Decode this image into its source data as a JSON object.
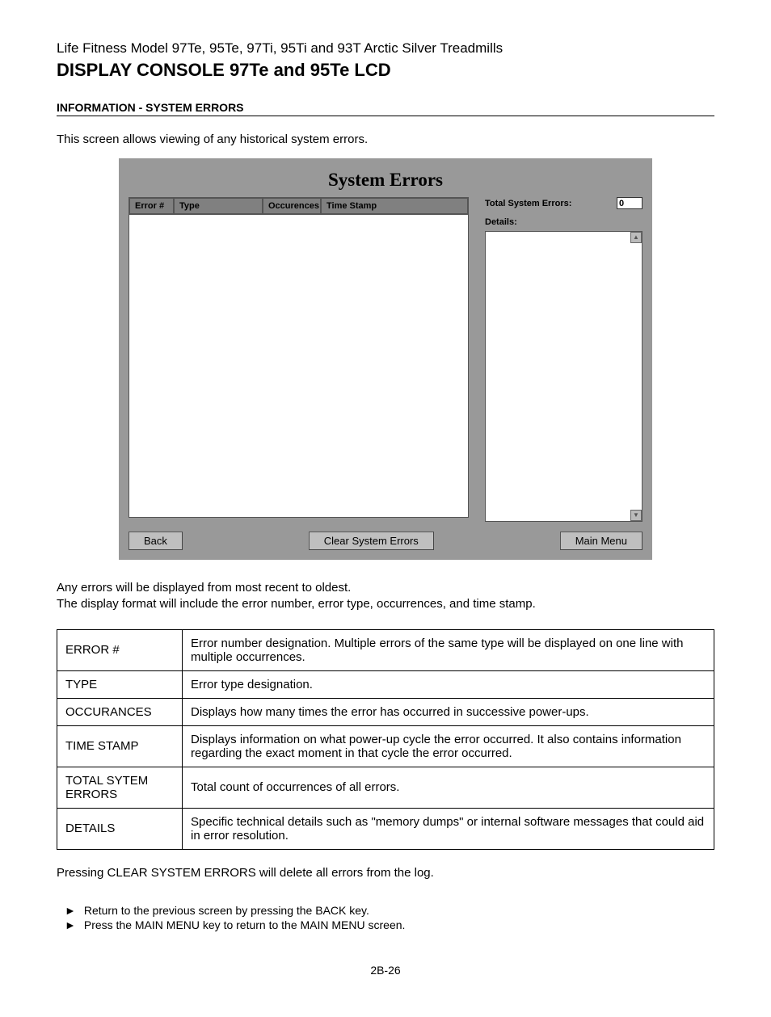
{
  "subtitle": "Life Fitness Model 97Te, 95Te, 97Ti, 95Ti and 93T Arctic Silver Treadmills",
  "title": "DISPLAY CONSOLE 97Te and 95Te LCD",
  "sectionHeader": "INFORMATION - SYSTEM ERRORS",
  "intro": "This screen allows viewing of any historical system errors.",
  "screen": {
    "title": "System Errors",
    "cols": {
      "c1": "Error #",
      "c2": "Type",
      "c3": "Occurences",
      "c4": "Time Stamp"
    },
    "totalLabel": "Total System Errors:",
    "totalValue": "0",
    "detailsLabel": "Details:",
    "btnBack": "Back",
    "btnClear": "Clear System Errors",
    "btnMain": "Main Menu"
  },
  "postLine1": "Any errors will be displayed from most recent to oldest.",
  "postLine2": "The display format will include the error number, error type, occurrences, and time stamp.",
  "definitions": [
    {
      "term": "ERROR #",
      "desc": "Error number designation. Multiple errors of the same type will be displayed on one line with multiple occurrences."
    },
    {
      "term": "TYPE",
      "desc": "Error type designation."
    },
    {
      "term": "OCCURANCES",
      "desc": "Displays how many times the error has occurred in successive power-ups."
    },
    {
      "term": "TIME STAMP",
      "desc": "Displays information on what power-up cycle the error occurred. It also contains information regarding the exact moment in that cycle the error occurred."
    },
    {
      "term": "TOTAL SYTEM ERRORS",
      "desc": "Total count of occurrences of all errors."
    },
    {
      "term": "DETAILS",
      "desc": "Specific technical details such as \"memory dumps\" or internal software messages that could aid in error resolution."
    }
  ],
  "note": "Pressing CLEAR SYSTEM ERRORS will delete all errors from the log.",
  "bullets": [
    "Return to the previous screen by pressing the BACK key.",
    "Press the MAIN MENU key to return to the MAIN MENU screen."
  ],
  "pageNum": "2B-26"
}
